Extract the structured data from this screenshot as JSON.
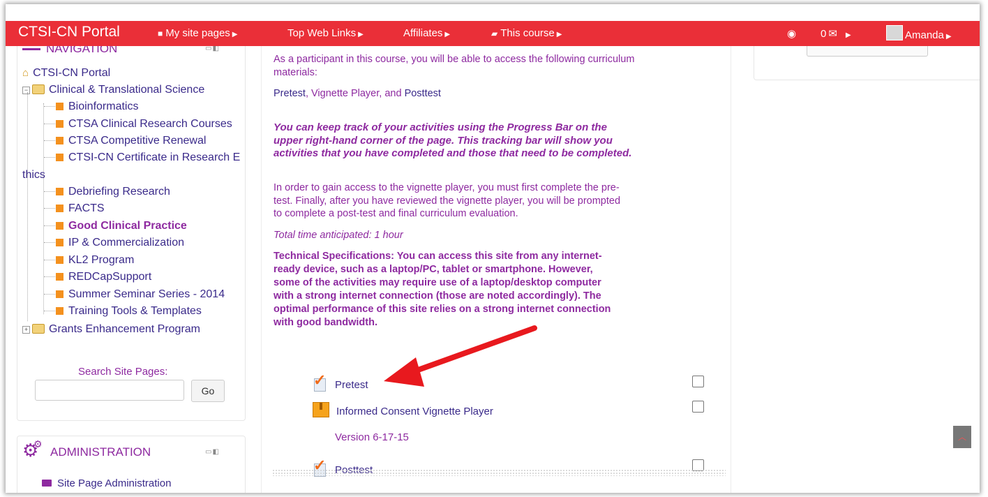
{
  "navbar": {
    "brand": "CTSI-CN Portal",
    "items": [
      "My site pages",
      "Top Web Links",
      "Affiliates",
      "This course"
    ],
    "notif_icon": "circle-arrow-icon",
    "messages": "0",
    "user": "Amanda"
  },
  "navigation": {
    "title": "NAVIGATION",
    "root": "CTSI-CN Portal",
    "folder1": "Clinical & Translational Science",
    "leaves": [
      "Bioinformatics",
      "CTSA Clinical Research Courses",
      "CTSA Competitive Renewal",
      "CTSI-CN Certificate in Research E",
      "Debriefing Research",
      "FACTS",
      "Good Clinical Practice",
      "IP & Commercialization",
      "KL2 Program",
      "REDCapSupport",
      "Summer Seminar Series - 2014",
      "Training Tools & Templates"
    ],
    "wrap": "thics",
    "folder2": "Grants Enhancement Program"
  },
  "search": {
    "label": "Search Site Pages:",
    "value": "",
    "go": "Go"
  },
  "administration": {
    "title": "ADMINISTRATION",
    "item": "Site Page Administration"
  },
  "content": {
    "intro_line1": "As a participant in this course, you will be able to access the following curriculum",
    "intro_line2": "materials:",
    "materials_a": "Pretest",
    "materials_sep1": ", ",
    "materials_b": "Vignette Player",
    "materials_sep2": ", and ",
    "materials_c": "Posttest",
    "progress_l1": "You can keep track of your activities using the Progress Bar on the",
    "progress_l2": "upper right-hand corner of the page.  This tracking bar will show you",
    "progress_l3": "activities that you have completed and those that need to be completed.",
    "order_l1": "In order to gain access to the vignette player, you must first complete the pre-",
    "order_l2": "test. Finally, after you have reviewed  the vignette player, you will be prompted",
    "order_l3": "to complete a post-test and final curriculum evaluation.",
    "time": "Total time anticipated: 1 hour",
    "tech_l1": "Technical Specifications:  You can access this site from any internet-",
    "tech_l2": "ready device, such as a laptop/PC, tablet or smartphone.  However,",
    "tech_l3": "some of the activities may require use of a laptop/desktop computer",
    "tech_l4": "with a strong internet connection (those are noted accordingly).  The",
    "tech_l5": "optimal performance of this site relies on a strong internet connection",
    "tech_l6": "with good bandwidth."
  },
  "activities": [
    {
      "label": "Pretest",
      "icon": "quiz-check-icon",
      "completed": false
    },
    {
      "label": "Informed Consent Vignette Player",
      "icon": "package-icon",
      "completed": false
    },
    {
      "label": "Posttest",
      "icon": "quiz-check-icon",
      "completed": false
    }
  ],
  "version": "Version 6-17-15",
  "colors": {
    "navbar": "#ea2f38",
    "accent_purple": "#8e2aa0",
    "link_navy": "#3a2a8a",
    "arrow": "#e8191e"
  }
}
